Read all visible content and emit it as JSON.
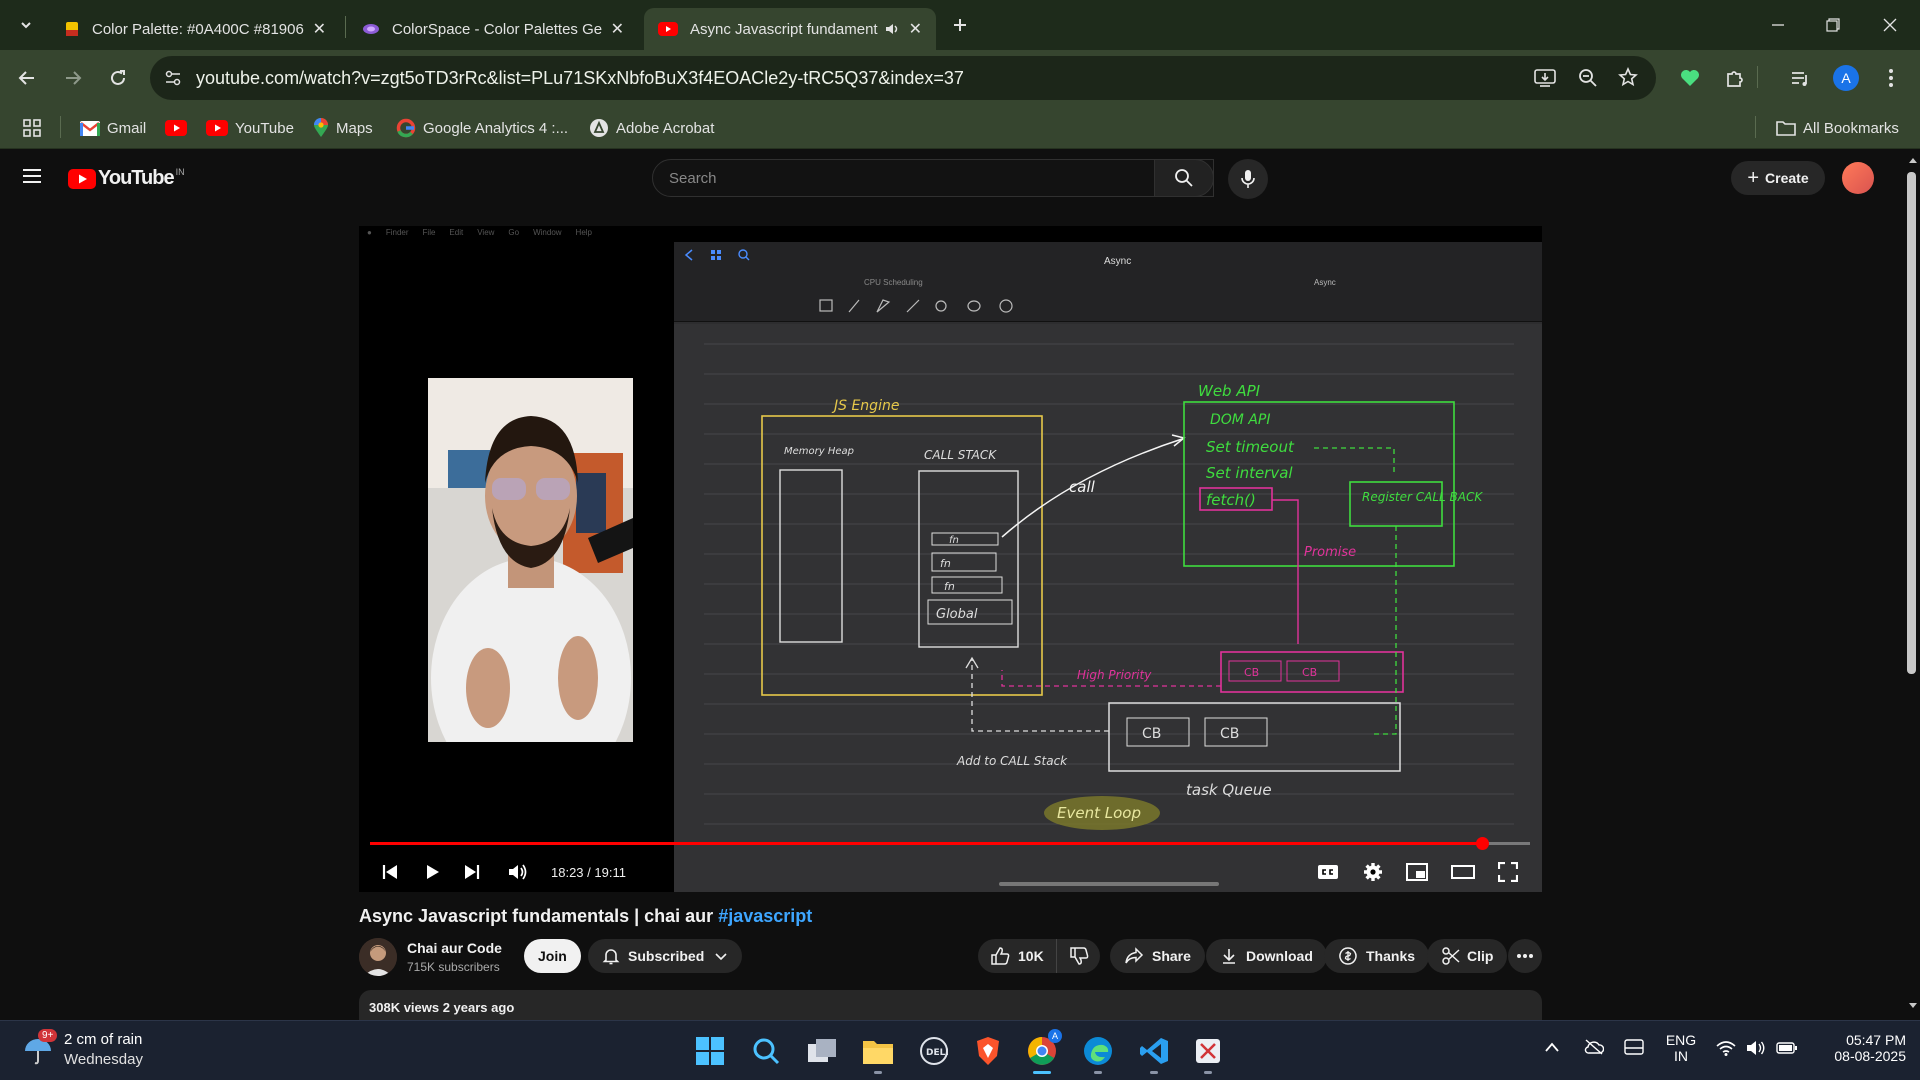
{
  "browser": {
    "tabs": [
      {
        "title": "Color Palette: #0A400C #81906",
        "favicon": "palette-icon",
        "active": false
      },
      {
        "title": "ColorSpace - Color Palettes Gen",
        "favicon": "colorspace-icon",
        "active": false
      },
      {
        "title": "Async Javascript fundament",
        "favicon": "youtube-icon",
        "active": true,
        "audio": true
      }
    ],
    "url": "youtube.com/watch?v=zgt5oTD3rRc&list=PLu71SKxNbfoBuX3f4EOACle2y-tRC5Q37&index=37",
    "profile_initial": "A",
    "bookmarks": [
      {
        "label": "Gmail",
        "icon": "gmail-icon"
      },
      {
        "label": "",
        "icon": "youtube-icon"
      },
      {
        "label": "YouTube",
        "icon": "youtube-icon"
      },
      {
        "label": "Maps",
        "icon": "maps-icon"
      },
      {
        "label": "Google Analytics 4 :...",
        "icon": "google-icon"
      },
      {
        "label": "Adobe Acrobat",
        "icon": "acrobat-icon"
      }
    ],
    "all_bookmarks": "All Bookmarks"
  },
  "youtube": {
    "logo_text": "YouTube",
    "country_code": "IN",
    "search_placeholder": "Search",
    "create_label": "Create"
  },
  "video": {
    "current_time": "18:23 / 19:11",
    "progress": 0.9583,
    "title_main": "Async Javascript fundamentals | chai aur ",
    "title_tag": "#javascript",
    "channel": "Chai aur Code",
    "subscribers": "715K subscribers",
    "join_label": "Join",
    "subscribed_label": "Subscribed",
    "likes": "10K",
    "share_label": "Share",
    "download_label": "Download",
    "thanks_label": "Thanks",
    "clip_label": "Clip",
    "views_age": "308K views  2 years ago"
  },
  "video_frame": {
    "mac_menu": [
      "Finder",
      "File",
      "Edit",
      "View",
      "Go",
      "Window",
      "Help"
    ],
    "notes_title": "Async",
    "notes_tab_left": "CPU Scheduling",
    "notes_tab_right": "Async",
    "board": {
      "js_engine": "JS Engine",
      "memory_heap": "Memory Heap",
      "call_stack": "CALL STACK",
      "stack_items": [
        "fn",
        "fn",
        "fn",
        "Global"
      ],
      "call": "call",
      "web_api": "Web API",
      "dom_api": "DOM API",
      "set_timeout": "Set timeout",
      "set_interval": "Set interval",
      "fetch": "fetch()",
      "register_callback": "Register CALL BACK",
      "promise": "Promise",
      "high_priority": "High Priority",
      "cb": "CB",
      "add_to_call_stack": "Add to CALL Stack",
      "task_queue": "task Queue",
      "event_loop": "Event Loop"
    }
  },
  "taskbar": {
    "weather_badge": "9+",
    "weather_temp": "2 cm of rain",
    "weather_day": "Wednesday",
    "lang_top": "ENG",
    "lang_bottom": "IN",
    "time": "05:47 PM",
    "date": "08-08-2025"
  },
  "colors": {
    "chrome_frame": "#1e2b1b",
    "chrome_toolbar": "#36452f",
    "yt_bg": "#0f0f0f",
    "progress_red": "#ff0000",
    "board_yellow": "#e6c84a",
    "board_green": "#3fdc3f",
    "board_magenta": "#e0339a"
  }
}
